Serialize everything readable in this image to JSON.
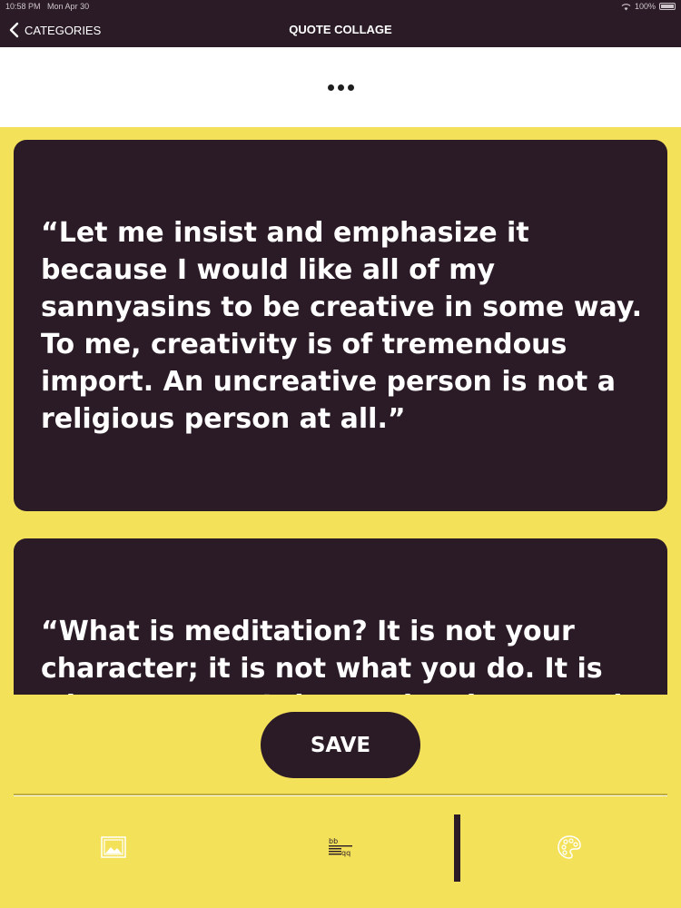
{
  "status_bar": {
    "time": "10:58 PM",
    "date": "Mon Apr 30",
    "battery": "100%"
  },
  "nav": {
    "back_label": "CATEGORIES",
    "title": "QUOTE COLLAGE"
  },
  "quotes": [
    {
      "text": "“Let me insist and emphasize it because I would like all of my sannyasins to be creative in some way. To me, creativity is of tremendous import. An uncreative person is not a religious person at all.”"
    },
    {
      "text": "“What is meditation? It is not your character; it is not what you do. It is what you are. It is not the character, it is"
    }
  ],
  "actions": {
    "save_label": "SAVE"
  },
  "tabs": [
    {
      "name": "image-tab",
      "icon": "image-frame-icon"
    },
    {
      "name": "text-style-tab",
      "icon": "text-style-icon"
    },
    {
      "name": "color-tab",
      "icon": "palette-icon"
    }
  ],
  "colors": {
    "background": "#f4e15a",
    "dark": "#2b1b26",
    "white": "#ffffff"
  }
}
